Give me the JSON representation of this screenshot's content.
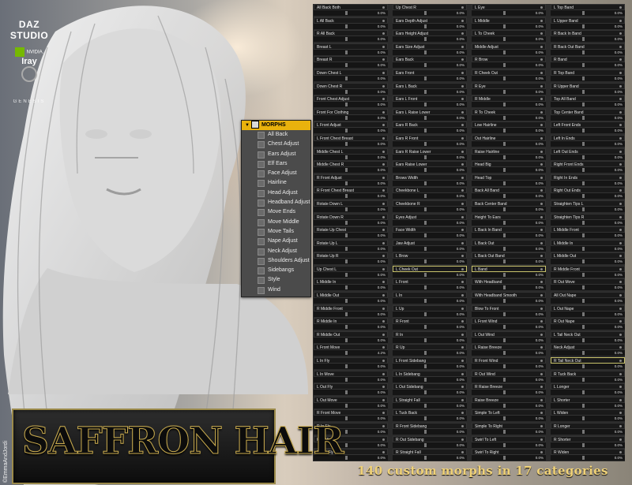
{
  "brand": {
    "daz": "DAZ STUDIO",
    "daz_sub": "",
    "nvidia": "NVIDIA.",
    "iray": "Iray",
    "genesis": "GENESIS"
  },
  "menu": {
    "header": "MORPHS",
    "items": [
      "All Back",
      "Chest Adjust",
      "Ears Adjust",
      "Elf Ears",
      "Face Adjust",
      "Hairline",
      "Head Adjust",
      "Headband Adjust",
      "Move Ends",
      "Move Middle",
      "Move Tails",
      "Nape Adjust",
      "Neck Adjust",
      "Shoulders Adjust",
      "Sidebangs",
      "Style",
      "Wind"
    ]
  },
  "columns": [
    [
      {
        "label": "All Back Both",
        "value": 0.0
      },
      {
        "label": "L All Back",
        "value": 0.0
      },
      {
        "label": "R All Back",
        "value": 0.0
      },
      {
        "label": "Breast L",
        "value": 0.0
      },
      {
        "label": "Breast R",
        "value": 0.0
      },
      {
        "label": "Down Chest L",
        "value": 0.0
      },
      {
        "label": "Down Chest R",
        "value": 0.0
      },
      {
        "label": "Front Chest Adjust",
        "value": 0.0
      },
      {
        "label": "Front For Clothing",
        "value": 0.0
      },
      {
        "label": "L Front Adjust",
        "value": 0.0
      },
      {
        "label": "L Front Chest Breast",
        "value": 0.0
      },
      {
        "label": "Middle Chest L",
        "value": 0.0
      },
      {
        "label": "Middle Chest R",
        "value": 0.0
      },
      {
        "label": "R Front Adjust",
        "value": 0.0
      },
      {
        "label": "R Front Chest Breast",
        "value": 0.0
      },
      {
        "label": "Rotate Down L",
        "value": 0.0
      },
      {
        "label": "Rotate Down R",
        "value": 0.0
      },
      {
        "label": "Rotate Up Chest",
        "value": 0.0
      },
      {
        "label": "Rotate Up L",
        "value": 0.0
      },
      {
        "label": "Rotate Up R",
        "value": 0.0
      },
      {
        "label": "Up Chest L",
        "value": 0.0
      },
      {
        "label": "L Middle In",
        "value": 0.0
      },
      {
        "label": "L Middle Out",
        "value": 0.0
      },
      {
        "label": "R Middle Front",
        "value": 0.0
      },
      {
        "label": "R Middle In",
        "value": 0.0
      },
      {
        "label": "R Middle Out",
        "value": 0.0
      },
      {
        "label": "L Front Move",
        "value": 0.0
      },
      {
        "label": "L In Fly",
        "value": 0.0
      },
      {
        "label": "L In Move",
        "value": 0.0
      },
      {
        "label": "L Out Fly",
        "value": 0.0
      },
      {
        "label": "L Out Move",
        "value": 0.0
      },
      {
        "label": "R Front Move",
        "value": 0.0
      },
      {
        "label": "R In Fly",
        "value": 0.0
      },
      {
        "label": "R In Move",
        "value": 0.0
      },
      {
        "label": "R Out Fly",
        "value": 0.0
      }
    ],
    [
      {
        "label": "Up Chest R",
        "value": 0.0
      },
      {
        "label": "Ears Depth Adjust",
        "value": 0.0
      },
      {
        "label": "Ears Height Adjust",
        "value": 0.0
      },
      {
        "label": "Ears Size Adjust",
        "value": 0.0
      },
      {
        "label": "Ears Back",
        "value": 0.0
      },
      {
        "label": "Ears Front",
        "value": 0.0
      },
      {
        "label": "Ears L Back",
        "value": 0.0
      },
      {
        "label": "Ears L Front",
        "value": 0.0
      },
      {
        "label": "Ears L Raise Lower",
        "value": 0.0
      },
      {
        "label": "Ears R Back",
        "value": 0.0
      },
      {
        "label": "Ears R Front",
        "value": 0.0
      },
      {
        "label": "Ears R Raise Lower",
        "value": 0.0
      },
      {
        "label": "Ears Raise Lower",
        "value": 0.0
      },
      {
        "label": "Brows Width",
        "value": 0.0
      },
      {
        "label": "Cheekbone L",
        "value": 0.0
      },
      {
        "label": "Cheekbone R",
        "value": 0.0
      },
      {
        "label": "Eyes Adjust",
        "value": 0.0
      },
      {
        "label": "Face Width",
        "value": 0.0
      },
      {
        "label": "Jaw Adjust",
        "value": 0.0
      },
      {
        "label": "L Brow",
        "value": 0.0
      },
      {
        "label": "L Cheek Out",
        "value": 0.0
      },
      {
        "label": "L Front",
        "value": 0.0
      },
      {
        "label": "L In",
        "value": 0.0
      },
      {
        "label": "L Up",
        "value": 0.0
      },
      {
        "label": "R Front",
        "value": 0.0
      },
      {
        "label": "R In",
        "value": 0.0
      },
      {
        "label": "R Up",
        "value": 0.0
      },
      {
        "label": "L Front Sidebang",
        "value": 0.0
      },
      {
        "label": "L In Sidebang",
        "value": 0.0
      },
      {
        "label": "L Out Sidebang",
        "value": 0.0
      },
      {
        "label": "L Straight Fall",
        "value": 0.0
      },
      {
        "label": "L Tuck Back",
        "value": 0.0
      },
      {
        "label": "R Front Sidebang",
        "value": 0.0
      },
      {
        "label": "R Out Sidebang",
        "value": 0.0
      },
      {
        "label": "R Straight Fall",
        "value": 0.0
      }
    ],
    [
      {
        "label": "L Eye",
        "value": 0.0
      },
      {
        "label": "L Middle",
        "value": 0.0
      },
      {
        "label": "L To Cheek",
        "value": 0.0
      },
      {
        "label": "Middle Adjust",
        "value": 0.0
      },
      {
        "label": "R Brow",
        "value": 0.0
      },
      {
        "label": "R Cheek Out",
        "value": 0.0
      },
      {
        "label": "R Eye",
        "value": 0.0
      },
      {
        "label": "R Middle",
        "value": 0.0
      },
      {
        "label": "R To Cheek",
        "value": 0.0
      },
      {
        "label": "Low Hairline",
        "value": 0.0
      },
      {
        "label": "Out Hairline",
        "value": 0.0
      },
      {
        "label": "Raise Hairline",
        "value": 0.0
      },
      {
        "label": "Head Big",
        "value": 0.0
      },
      {
        "label": "Head Top",
        "value": 0.0
      },
      {
        "label": "Back All Band",
        "value": 0.0
      },
      {
        "label": "Back Center Band",
        "value": 0.0
      },
      {
        "label": "Height To Ears",
        "value": 0.0
      },
      {
        "label": "L Back In Band",
        "value": 0.0
      },
      {
        "label": "L Back Out",
        "value": 0.0
      },
      {
        "label": "L Back Out Band",
        "value": 0.0
      },
      {
        "label": "L Band",
        "value": 0.0
      },
      {
        "label": "With Headband",
        "value": 0.0
      },
      {
        "label": "With Headband Smooth",
        "value": 0.0
      },
      {
        "label": "Blow To Front",
        "value": 0.0
      },
      {
        "label": "L Front Wind",
        "value": 0.0
      },
      {
        "label": "L Out Wind",
        "value": 0.0
      },
      {
        "label": "L Raise Breeze",
        "value": 0.0
      },
      {
        "label": "R Front Wind",
        "value": 0.0
      },
      {
        "label": "R Out Wind",
        "value": 0.0
      },
      {
        "label": "R Raise Breeze",
        "value": 0.0
      },
      {
        "label": "Raise Breeze",
        "value": 0.0
      },
      {
        "label": "Simple To Left",
        "value": 0.0
      },
      {
        "label": "Simple To Right",
        "value": 0.0
      },
      {
        "label": "Swirl To Left",
        "value": 0.0
      },
      {
        "label": "Swirl To Right",
        "value": 0.0
      }
    ],
    [
      {
        "label": "L Top Band",
        "value": 0.0
      },
      {
        "label": "L Upper Band",
        "value": 0.0
      },
      {
        "label": "R Back In Band",
        "value": 0.0
      },
      {
        "label": "R Back Out Band",
        "value": 0.0
      },
      {
        "label": "R Band",
        "value": 0.0
      },
      {
        "label": "R Top Band",
        "value": 0.0
      },
      {
        "label": "R Upper Band",
        "value": 0.0
      },
      {
        "label": "Top All Band",
        "value": 0.0
      },
      {
        "label": "Top Center Band",
        "value": 0.0
      },
      {
        "label": "Left Front Ends",
        "value": 0.0
      },
      {
        "label": "Left In Ends",
        "value": 0.0
      },
      {
        "label": "Left Out Ends",
        "value": 0.0
      },
      {
        "label": "Right Front Ends",
        "value": 0.0
      },
      {
        "label": "Right In Ends",
        "value": 0.0
      },
      {
        "label": "Right Out Ends",
        "value": 0.0
      },
      {
        "label": "Straighten Tips L",
        "value": 0.0
      },
      {
        "label": "Straighten Tips R",
        "value": 0.0
      },
      {
        "label": "L Middle Front",
        "value": 0.0
      },
      {
        "label": "L Middle In",
        "value": 0.0
      },
      {
        "label": "L Middle Out",
        "value": 0.0
      },
      {
        "label": "R Middle Front",
        "value": 0.0
      },
      {
        "label": "R Out Move",
        "value": 0.0
      },
      {
        "label": "All Out Nape",
        "value": 0.0
      },
      {
        "label": "L Out Nape",
        "value": 0.0
      },
      {
        "label": "R Out Nape",
        "value": 0.0
      },
      {
        "label": "L Tail Neck Out",
        "value": 0.0
      },
      {
        "label": "Neck Adjust",
        "value": 0.0
      },
      {
        "label": "R Tail Neck Out",
        "value": 0.0
      },
      {
        "label": "R Tuck Back",
        "value": 0.0
      },
      {
        "label": "L Longer",
        "value": 0.0
      },
      {
        "label": "L Shorter",
        "value": 0.0
      },
      {
        "label": "L Widen",
        "value": 0.0
      },
      {
        "label": "R Longer",
        "value": 0.0
      },
      {
        "label": "R Shorter",
        "value": 0.0
      },
      {
        "label": "R Widen",
        "value": 0.0
      }
    ]
  ],
  "highlight_value": "4.2%",
  "caption": "140 custom morphs in 17 categories",
  "title": "SAFFRON HAIR",
  "credit": "©EmmaAndJordi",
  "accent": "#c8c26b"
}
